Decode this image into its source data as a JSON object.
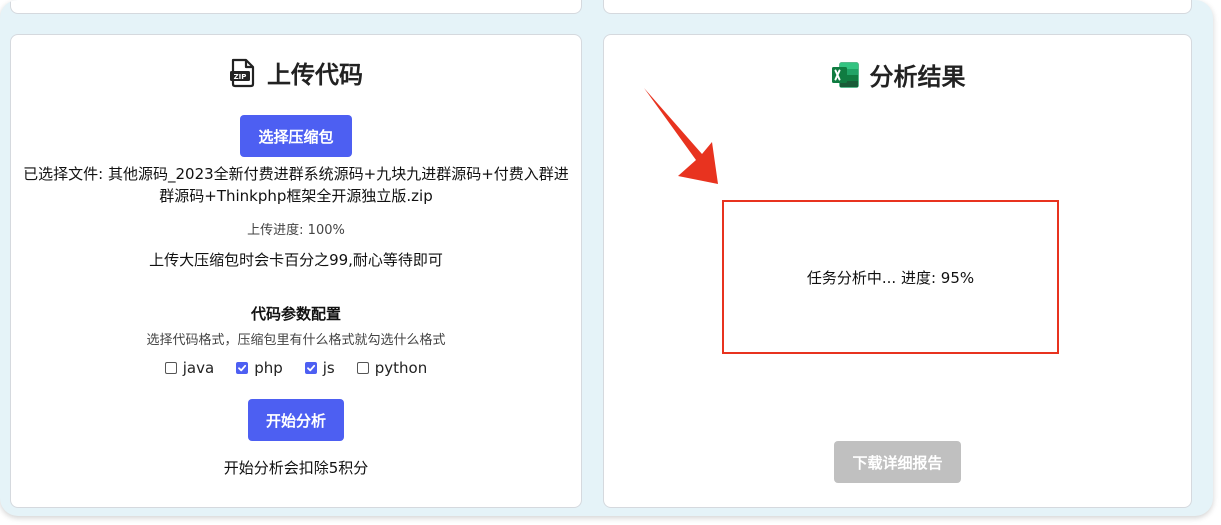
{
  "upload_card": {
    "title": "上传代码",
    "title_icon": "zip-file-icon",
    "select_button": "选择压缩包",
    "selected_file": "已选择文件: 其他源码_2023全新付费进群系统源码+九块九进群源码+付费入群进群源码+Thinkphp框架全开源独立版.zip",
    "upload_progress": "上传进度: 100%",
    "upload_note": "上传大压缩包时会卡百分之99,耐心等待即可",
    "config_title": "代码参数配置",
    "config_hint": "选择代码格式，压缩包里有什么格式就勾选什么格式",
    "formats": [
      {
        "label": "java",
        "checked": false
      },
      {
        "label": "php",
        "checked": true
      },
      {
        "label": "js",
        "checked": true
      },
      {
        "label": "python",
        "checked": false
      }
    ],
    "start_button": "开始分析",
    "start_note": "开始分析会扣除5积分"
  },
  "result_card": {
    "title": "分析结果",
    "title_icon": "excel-icon",
    "status": "任务分析中... 进度: 95%",
    "progress_percent": 95,
    "download_button": "下载详细报告"
  },
  "colors": {
    "primary": "#4d5ff2",
    "disabled": "#c0c0c0",
    "annotation": "#e8331f",
    "background": "#e5f3f8"
  }
}
